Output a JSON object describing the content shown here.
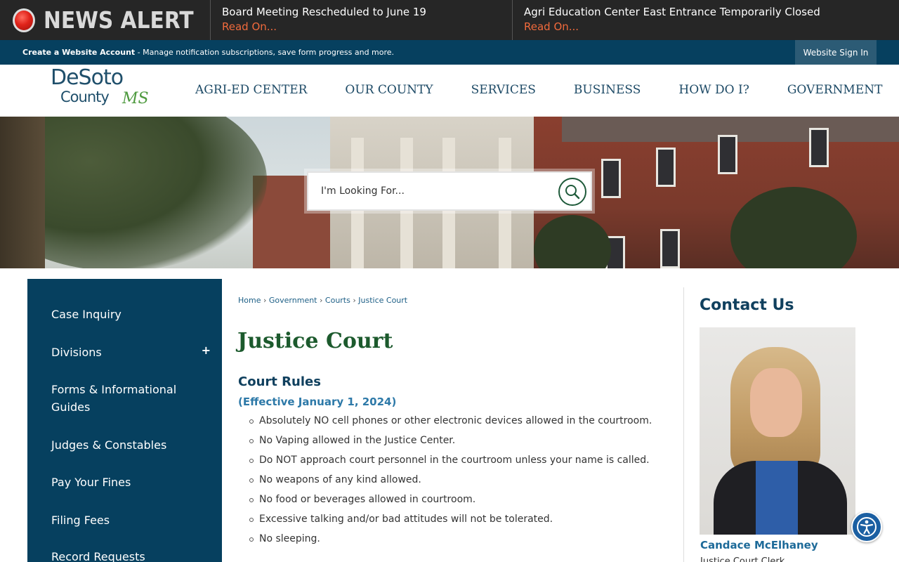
{
  "news_alert": {
    "label": "NEWS ALERT",
    "items": [
      {
        "title": "Board Meeting Rescheduled to June 19",
        "link": "Read On..."
      },
      {
        "title": "Agri Education Center East Entrance Temporarily Closed",
        "link": "Read On..."
      }
    ]
  },
  "account_bar": {
    "create_account": "Create a Website Account",
    "description": " - Manage notification subscriptions, save form progress and more.",
    "sign_in": "Website Sign In"
  },
  "logo": {
    "line1": "DeSoto",
    "line2": "County",
    "suffix": "MS"
  },
  "nav": [
    "AGRI-ED CENTER",
    "OUR COUNTY",
    "SERVICES",
    "BUSINESS",
    "HOW DO I?",
    "GOVERNMENT"
  ],
  "search": {
    "placeholder": "I'm Looking For..."
  },
  "sidebar": {
    "items": [
      "Case Inquiry",
      "Divisions",
      "Forms & Informational Guides",
      "Judges & Constables",
      "Pay Your Fines",
      "Filing Fees",
      "Record Requests"
    ],
    "expand_symbol": "+"
  },
  "breadcrumb": {
    "items": [
      "Home",
      "Government",
      "Courts",
      "Justice Court"
    ],
    "separator": "›"
  },
  "page_title": "Justice Court",
  "section": {
    "heading": "Court Rules",
    "subheading": "(Effective January 1, 2024)",
    "rules": [
      "Absolutely NO cell phones or other electronic devices allowed in the courtroom.",
      "No Vaping allowed in the Justice Center.",
      "Do NOT approach court personnel in the courtroom unless your name is called.",
      "No weapons of any kind allowed.",
      "No food or beverages allowed in courtroom.",
      "Excessive talking and/or bad attitudes will not be tolerated.",
      "No sleeping."
    ]
  },
  "contact": {
    "title": "Contact Us",
    "name": "Candace McElhaney",
    "role": "Justice Court Clerk"
  },
  "colors": {
    "navy": "#06405f",
    "title_green": "#1c5a2d",
    "alert_link": "#f06a3c"
  }
}
